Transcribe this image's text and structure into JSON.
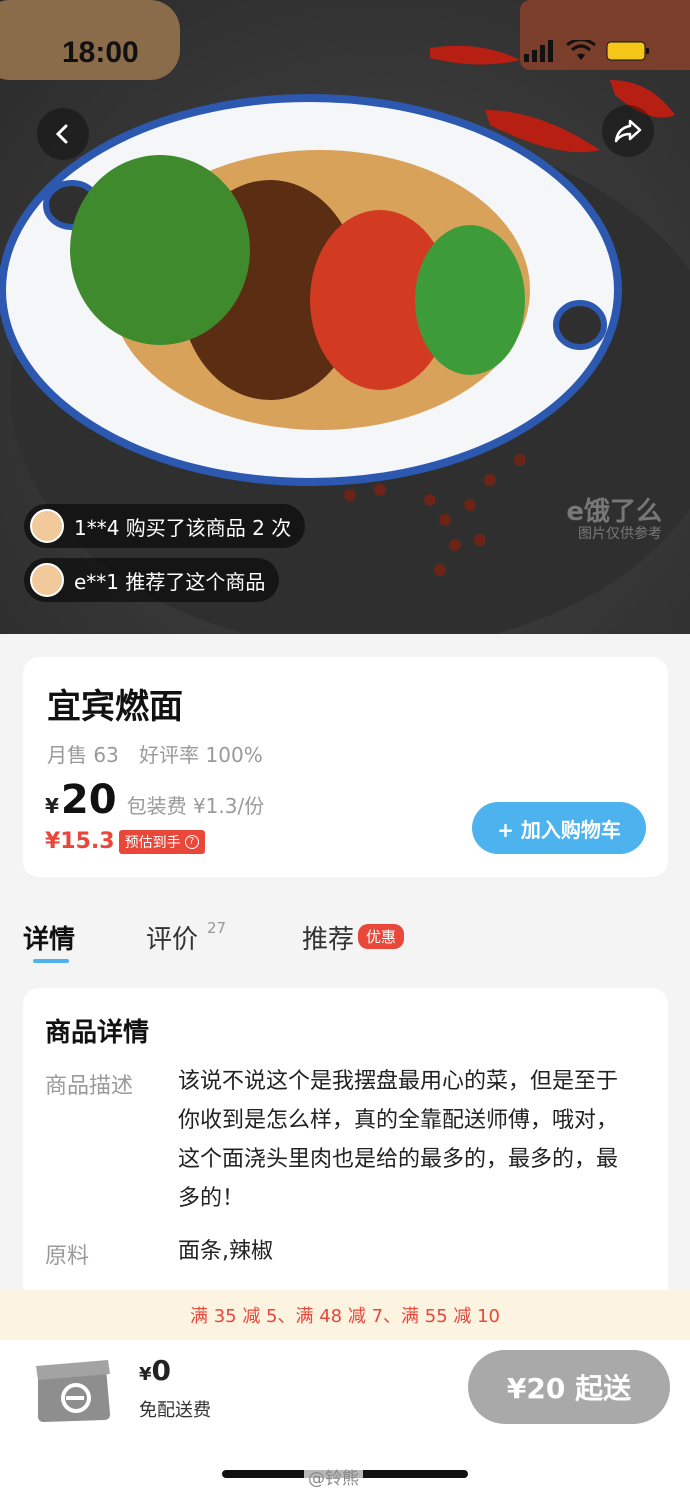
{
  "status_bar": {
    "time": "18:00"
  },
  "hero": {
    "watermark_main": "e饿了么",
    "watermark_sub": "图片仅供参考"
  },
  "social_proof": [
    {
      "text": "1**4 购买了该商品 2 次"
    },
    {
      "text": "e**1 推荐了这个商品"
    }
  ],
  "product": {
    "name": "宜宾燃面",
    "monthly_sales": "月售 63",
    "rating": "好评率 100%",
    "currency": "¥",
    "price": "20",
    "packing_fee": "包装费 ¥1.3/份",
    "estimated_price": "¥15.3",
    "estimated_label": "预估到手",
    "add_to_cart": "+ 加入购物车"
  },
  "tabs": {
    "detail": "详情",
    "reviews": "评价",
    "reviews_count": "27",
    "recommend": "推荐",
    "recommend_badge": "优惠"
  },
  "details": {
    "title": "商品详情",
    "desc_label": "商品描述",
    "desc_value": "该说不说这个是我摆盘最用心的菜，但是至于你收到是怎么样，真的全靠配送师傅，哦对，这个面浇头里肉也是给的最多的，最多的，最多的！",
    "ingredients_label": "原料",
    "ingredients_value": "面条,辣椒"
  },
  "promo": {
    "text": "满 35 减 5、满 48 减 7、满 55 减 10"
  },
  "cart": {
    "currency": "¥",
    "total": "0",
    "delivery": "免配送费",
    "min_order": "¥20 起送"
  },
  "footer": {
    "weibo_mark": "@铃熊"
  },
  "colors": {
    "accent_blue": "#4db3ef",
    "promo_red": "#e8473a",
    "promo_bg": "#fdf3e1",
    "disabled_gray": "#a9a9a9"
  }
}
